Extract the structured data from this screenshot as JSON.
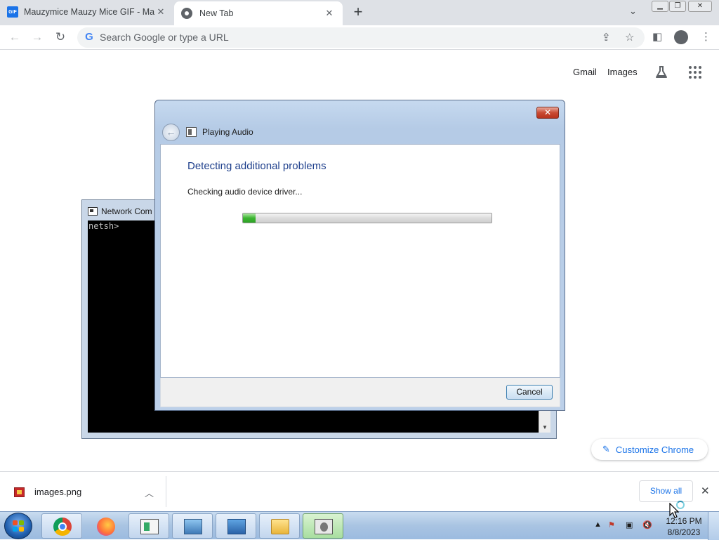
{
  "browser": {
    "tabs": [
      {
        "label": "Mauzymice Mauzy Mice GIF - Ma",
        "favicon": "GIF",
        "active": false
      },
      {
        "label": "New Tab",
        "active": true
      }
    ],
    "omnibox_placeholder": "Search Google or type a URL"
  },
  "ntp": {
    "gmail_label": "Gmail",
    "images_label": "Images",
    "customize_label": "Customize Chrome"
  },
  "console": {
    "title": "Network Com",
    "prompt": "netsh>"
  },
  "dialog": {
    "title": "Playing Audio",
    "heading": "Detecting additional problems",
    "status": "Checking audio device driver...",
    "progress_fraction": 0.05,
    "cancel_label": "Cancel"
  },
  "downloads": {
    "filename": "images.png",
    "show_all_label": "Show all"
  },
  "taskbar": {
    "time": "12:16 PM",
    "date": "8/8/2023"
  },
  "colors": {
    "chrome_accent": "#1a73e8",
    "dialog_heading": "#1e3f8c",
    "progress_green": "#3cb532"
  }
}
